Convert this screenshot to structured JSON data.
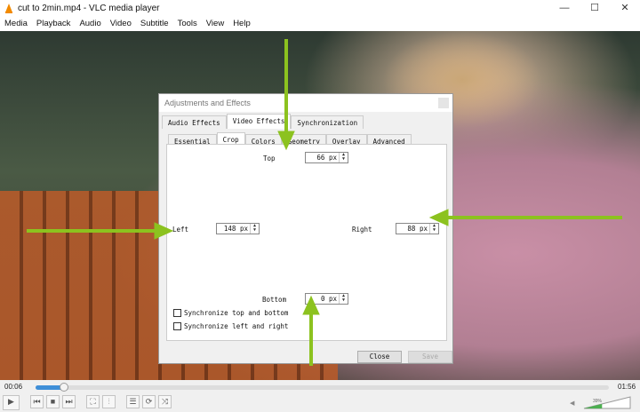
{
  "window": {
    "title": "cut to 2min.mp4 - VLC media player",
    "minimize": "—",
    "maximize": "☐",
    "close": "✕"
  },
  "menu": [
    "Media",
    "Playback",
    "Audio",
    "Video",
    "Subtitle",
    "Tools",
    "View",
    "Help"
  ],
  "dialog": {
    "title": "Adjustments and Effects",
    "tabs": [
      "Audio Effects",
      "Video Effects",
      "Synchronization"
    ],
    "active_tab": "Video Effects",
    "subtabs": [
      "Essential",
      "Crop",
      "Colors",
      "Geometry",
      "Overlay",
      "Advanced"
    ],
    "active_subtab": "Crop",
    "crop": {
      "top_label": "Top",
      "top": "66 px",
      "left_label": "Left",
      "left": "148 px",
      "right_label": "Right",
      "right": "88 px",
      "bottom_label": "Bottom",
      "bottom": "0 px"
    },
    "sync_tb": {
      "label": "Synchronize top and bottom",
      "checked": false
    },
    "sync_lr": {
      "label": "Synchronize left and right",
      "checked": false
    },
    "close_label": "Close",
    "save_label": "Save"
  },
  "player": {
    "elapsed": "00:06",
    "total": "01:56",
    "progress": 0.05,
    "volume": "39%",
    "volume_level": 0.39,
    "buttons": {
      "play": "▶",
      "prev": "⏮",
      "stop": "■",
      "next": "⏭",
      "fullscreen": "⛶",
      "extended": "⫶",
      "playlist": "☰",
      "loop": "⟳",
      "shuffle": "⤨",
      "mute": "🔈"
    }
  },
  "accent": "#8cc21f"
}
